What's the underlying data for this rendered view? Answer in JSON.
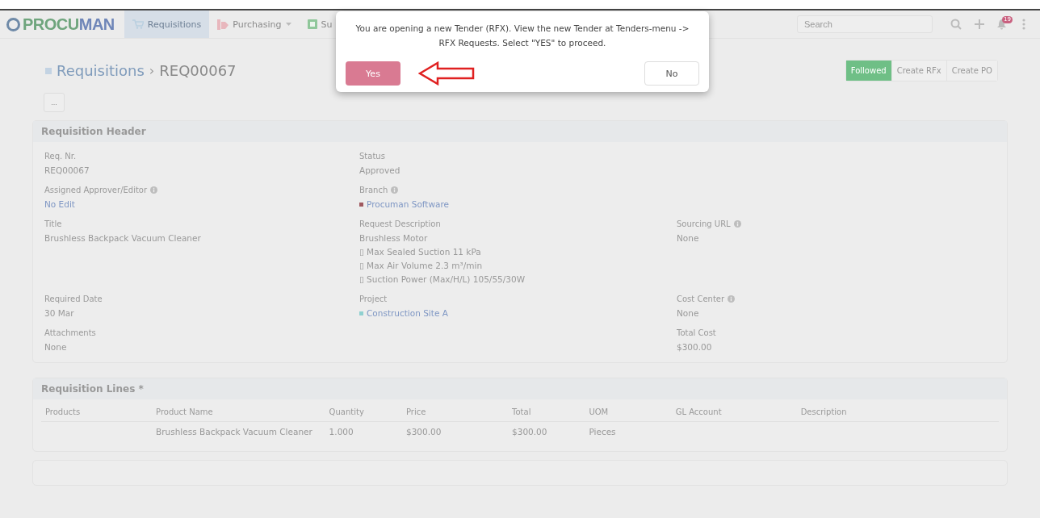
{
  "navbar": {
    "logo_a": "PROCU",
    "logo_b": "MAN",
    "items": [
      {
        "label": "Requisitions",
        "kind": "cart",
        "selected": true,
        "dropdown": false
      },
      {
        "label": "Purchasing",
        "kind": "tag",
        "selected": false,
        "dropdown": true
      },
      {
        "label": "Su",
        "kind": "doc",
        "selected": false,
        "dropdown": false
      }
    ],
    "search": {
      "placeholder": "Search"
    },
    "notification_count": "19"
  },
  "breadcrumb": {
    "parent": "Requisitions",
    "separator": "›",
    "current": "REQ00067"
  },
  "more_button": "...",
  "actions": [
    {
      "label": "Followed",
      "selected": true
    },
    {
      "label": "Create RFx",
      "selected": false
    },
    {
      "label": "Create PO",
      "selected": false
    }
  ],
  "header_section": {
    "title": "Requisition Header",
    "rows": [
      {
        "left": {
          "label": "Req. Nr.",
          "value": [
            "REQ00067"
          ],
          "kind": "text"
        },
        "middle": {
          "label": "Status",
          "value": [
            "Approved"
          ],
          "kind": "text"
        }
      },
      {
        "left": {
          "label": "Assigned Approver/Editor",
          "info": true,
          "value": [
            "No Edit"
          ],
          "kind": "link"
        },
        "middle": {
          "label": "Branch",
          "info": true,
          "value": [
            "Procuman Software"
          ],
          "kind": "link",
          "color": "#a0595f"
        }
      },
      {
        "left": {
          "label": "Title",
          "value": [
            "Brushless Backpack Vacuum Cleaner"
          ],
          "kind": "text"
        },
        "middle": {
          "label": "Request Description",
          "value": [
            "Brushless Motor",
            "▯ Max Sealed Suction 11 kPa",
            "▯ Max Air Volume 2.3 m³/min",
            "▯ Suction Power (Max/H/L) 105/55/30W"
          ],
          "kind": "text"
        },
        "right": {
          "label": "Sourcing URL",
          "info": true,
          "value": [
            "None"
          ],
          "kind": "text"
        }
      },
      {
        "left": {
          "label": "Required Date",
          "value": [
            "30 Mar"
          ],
          "kind": "text"
        },
        "middle": {
          "label": "Project",
          "value": [
            "Construction Site A"
          ],
          "kind": "link",
          "color": "#8fd0d0"
        },
        "right": {
          "label": "Cost Center",
          "info": true,
          "value": [
            "None"
          ],
          "kind": "text"
        }
      },
      {
        "left": {
          "label": "Attachments",
          "value": [
            "None"
          ],
          "kind": "text"
        },
        "right": {
          "label": "Total Cost",
          "value": [
            "$300.00"
          ],
          "kind": "text"
        }
      }
    ]
  },
  "lines_section": {
    "title": "Requisition Lines *",
    "columns": [
      "Products",
      "Product Name",
      "Quantity",
      "Price",
      "Total",
      "UOM",
      "GL Account",
      "Description"
    ],
    "rows": [
      [
        "",
        "Brushless Backpack Vacuum Cleaner",
        "1.000",
        "$300.00",
        "$300.00",
        "Pieces",
        "",
        ""
      ]
    ]
  },
  "dialog": {
    "message": "You are opening a new Tender (RFX). View the new Tender at Tenders-menu -> RFX Requests. Select \"YES\" to proceed.",
    "buttons": [
      {
        "label": "Yes",
        "kind": "primary"
      },
      {
        "label": "No",
        "kind": "secondary"
      }
    ]
  }
}
